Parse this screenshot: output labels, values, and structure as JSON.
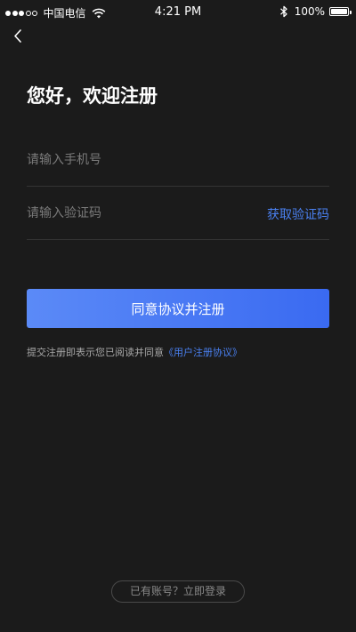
{
  "status_bar": {
    "carrier": "中国电信",
    "time": "4:21 PM",
    "battery": "100%",
    "signal_strength": "3 of 5 bars"
  },
  "nav": {
    "back_icon": "chevron-left-icon"
  },
  "main": {
    "title": "您好，欢迎注册",
    "phone_placeholder": "请输入手机号",
    "code_placeholder": "请输入验证码",
    "get_code_label": "获取验证码",
    "submit_label": "同意协议并注册",
    "agreement_text": "提交注册即表示您已阅读并同意",
    "agreement_link": "《用户注册协议》"
  },
  "footer": {
    "login_prompt": "已有账号？立即登录"
  },
  "colors": {
    "background": "#1b1b1b",
    "accent": "#4a80f0",
    "button_gradient_start": "#5b8af7",
    "button_gradient_end": "#3a6af1"
  }
}
